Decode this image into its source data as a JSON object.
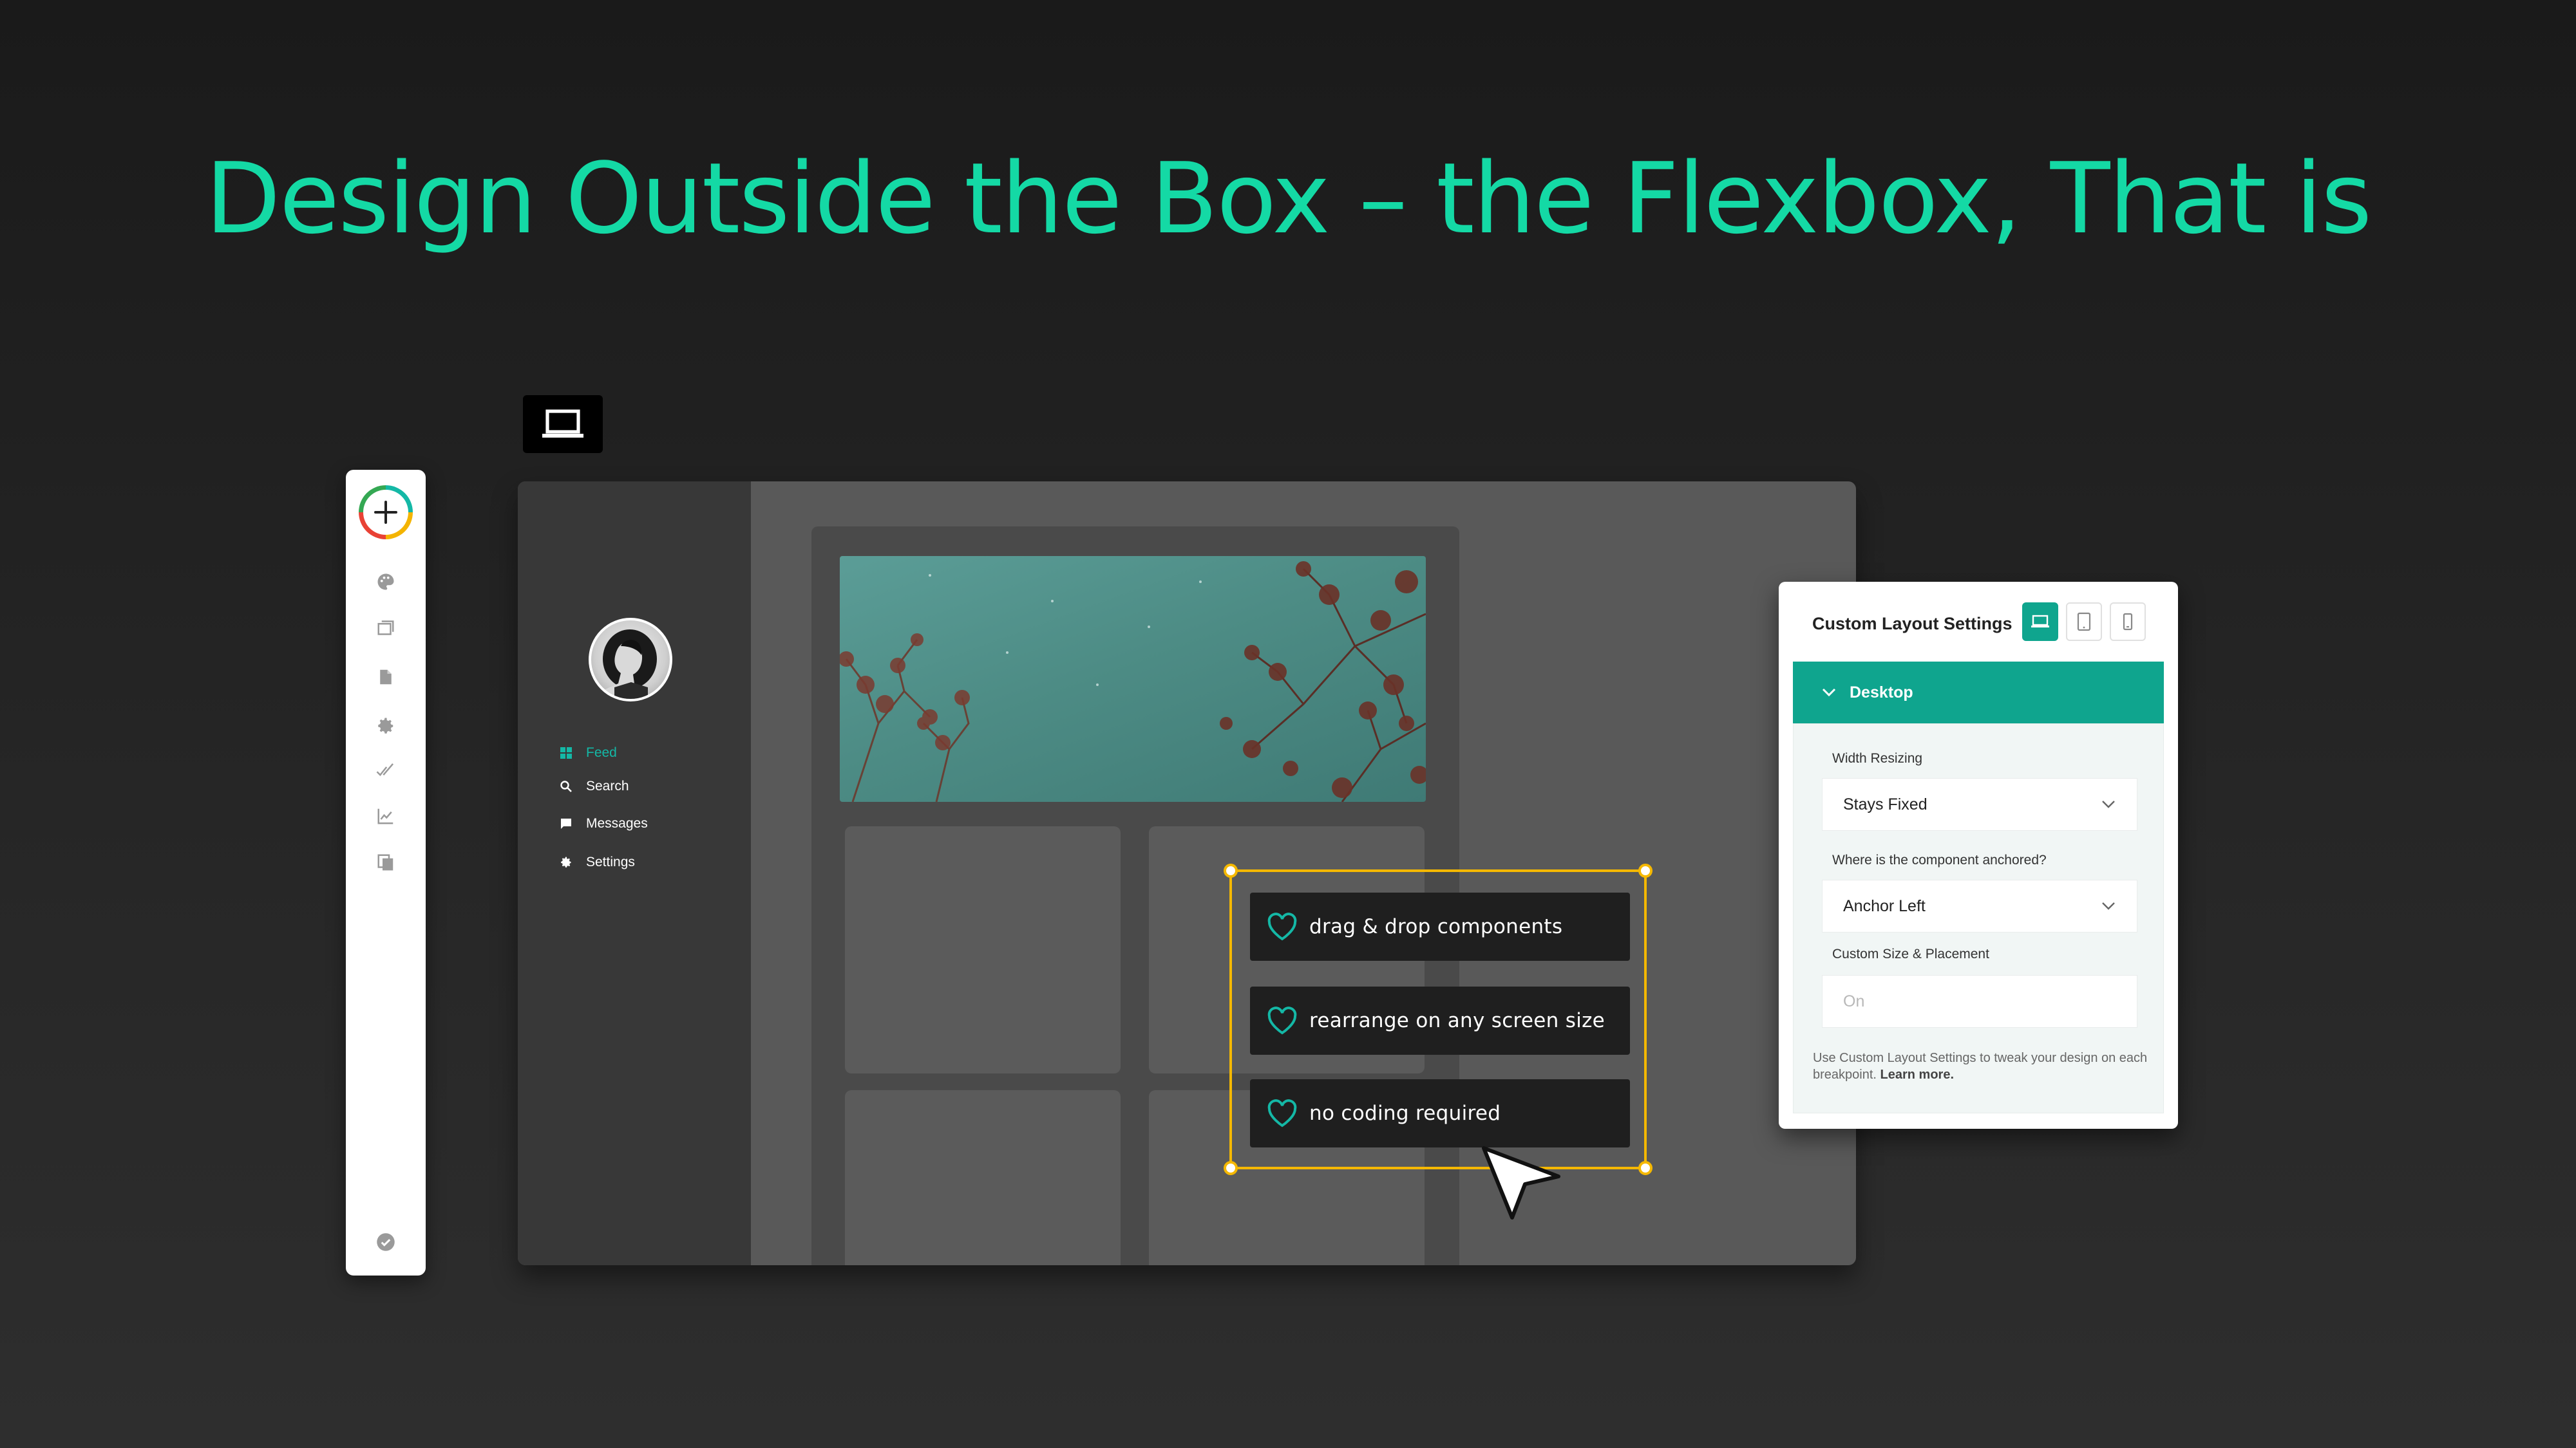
{
  "headline": "Design Outside the Box – the Flexbox, That is",
  "colors": {
    "accent": "#14d9a5",
    "teal": "#0fa58e",
    "selection": "#f5b800",
    "background": "#222222"
  },
  "toolbar": {
    "add_icon": "plus-icon",
    "items": [
      "palette-icon",
      "layers-icon",
      "document-icon",
      "gear-icon",
      "double-check-icon",
      "chart-icon",
      "copy-icon"
    ],
    "bottom_icon": "check-circle-icon"
  },
  "device_badge_icon": "laptop-icon",
  "app": {
    "nav": [
      {
        "label": "Feed",
        "icon": "grid-icon",
        "active": true
      },
      {
        "label": "Search",
        "icon": "search-icon",
        "active": false
      },
      {
        "label": "Messages",
        "icon": "message-icon",
        "active": false
      },
      {
        "label": "Settings",
        "icon": "gear-icon",
        "active": false
      }
    ]
  },
  "features": [
    "drag & drop components",
    "rearrange on any screen size",
    "no coding required"
  ],
  "settings": {
    "title": "Custom Layout Settings",
    "breakpoints": [
      "laptop-icon",
      "tablet-icon",
      "phone-icon"
    ],
    "active_breakpoint": 0,
    "section": "Desktop",
    "width_label": "Width Resizing",
    "width_value": "Stays Fixed",
    "anchor_label": "Where is the component anchored?",
    "anchor_value": "Anchor Left",
    "custom_label": "Custom Size & Placement",
    "custom_value": "On",
    "helper": "Use Custom Layout Settings to tweak your design on each breakpoint.",
    "learn_more": "Learn more."
  }
}
